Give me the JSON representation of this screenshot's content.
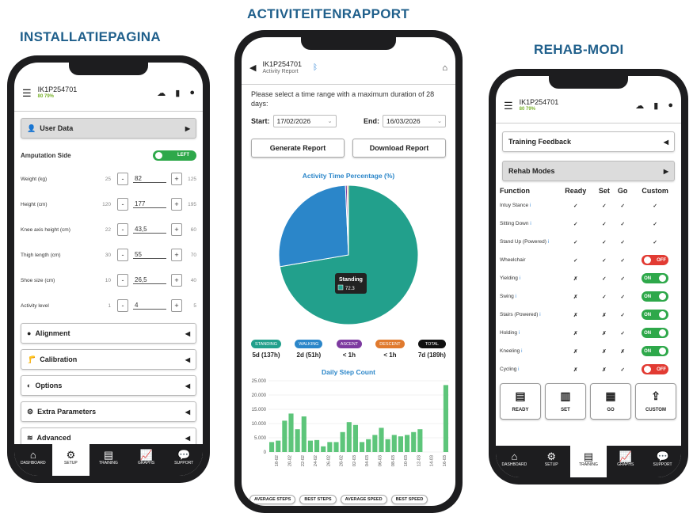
{
  "headings": {
    "left": "INSTALLATIEPAGINA",
    "middle": "ACTIVITEITENRAPPORT",
    "right": "REHAB-MODI"
  },
  "device": {
    "id": "IK1P254701",
    "battery": "80 79%"
  },
  "setup": {
    "user_data": "User Data",
    "amputation_side": "Amputation Side",
    "amputation_value": "LEFT",
    "fields": [
      {
        "label": "Weight (kg)",
        "min": "25",
        "value": "82",
        "max": "125"
      },
      {
        "label": "Height (cm)",
        "min": "120",
        "value": "177",
        "max": "195"
      },
      {
        "label": "Knee axis height (cm)",
        "min": "22",
        "value": "43,5",
        "max": "60"
      },
      {
        "label": "Thigh length (cm)",
        "min": "30",
        "value": "55",
        "max": "70"
      },
      {
        "label": "Shoe size (cm)",
        "min": "10",
        "value": "26,5",
        "max": "40"
      },
      {
        "label": "Activity level",
        "min": "1",
        "value": "4",
        "max": "5"
      }
    ],
    "sections": [
      "Alignment",
      "Calibration",
      "Options",
      "Extra Parameters",
      "Advanced"
    ]
  },
  "nav": [
    "DASHBOARD",
    "SETUP",
    "TRAINING",
    "GRAPHS",
    "SUPPORT"
  ],
  "report": {
    "title": "Activity Report",
    "instruction": "Please select a time range with a maximum duration of 28 days:",
    "start_label": "Start:",
    "start_value": "17/02/2026",
    "end_label": "End:",
    "end_value": "16/03/2026",
    "generate": "Generate Report",
    "download": "Download Report",
    "pie_title": "Activity Time Percentage (%)",
    "tooltip_label": "Standing",
    "tooltip_value": "72.3",
    "badges": [
      {
        "label": "STANDING",
        "value": "5d (137h)",
        "color": "#22a08c"
      },
      {
        "label": "WALKING",
        "value": "2d (51h)",
        "color": "#2b86c9"
      },
      {
        "label": "ASCENT",
        "value": "< 1h",
        "color": "#7d3aa0"
      },
      {
        "label": "DESCENT",
        "value": "< 1h",
        "color": "#e07a2e"
      },
      {
        "label": "TOTAL",
        "value": "7d (189h)",
        "color": "#111111"
      }
    ],
    "bar_title": "Daily Step Count",
    "bottom_tabs": [
      "AVERAGE STEPS",
      "BEST STEPS",
      "AVERAGE SPEED",
      "BEST SPEED"
    ]
  },
  "chart_data": [
    {
      "type": "pie",
      "title": "Activity Time Percentage (%)",
      "categories": [
        "Standing",
        "Walking",
        "Ascent",
        "Descent"
      ],
      "values": [
        72.3,
        27.0,
        0.4,
        0.3
      ],
      "colors": [
        "#22a08c",
        "#2b86c9",
        "#7d3aa0",
        "#e07a2e"
      ]
    },
    {
      "type": "bar",
      "title": "Daily Step Count",
      "yticks": [
        "0",
        "5.000",
        "10.000",
        "15.000",
        "20.000",
        "25.000"
      ],
      "ylim": [
        0,
        25000
      ],
      "categories": [
        "17-02",
        "18-02",
        "19-02",
        "20-02",
        "21-02",
        "22-02",
        "23-02",
        "24-02",
        "25-02",
        "26-02",
        "27-02",
        "28-02",
        "01-03",
        "02-03",
        "03-03",
        "04-03",
        "05-03",
        "06-03",
        "07-03",
        "08-03",
        "09-03",
        "10-03",
        "11-03",
        "12-03",
        "13-03",
        "14-03",
        "15-03",
        "16-03"
      ],
      "xticklabels": [
        "18-02",
        "20-02",
        "22-02",
        "24-02",
        "26-02",
        "28-02",
        "02-03",
        "04-03",
        "06-03",
        "08-03",
        "10-03",
        "12-03",
        "14-03",
        "16-03"
      ],
      "values": [
        3500,
        4000,
        11000,
        13500,
        8000,
        12500,
        4000,
        4200,
        2000,
        3500,
        3500,
        7000,
        10500,
        9500,
        3500,
        4500,
        6000,
        8500,
        4500,
        6000,
        5500,
        6000,
        7000,
        8000,
        0,
        0,
        0,
        23500
      ],
      "color": "#5dc57a"
    }
  ],
  "rehab": {
    "training_feedback": "Training Feedback",
    "rehab_modes": "Rehab Modes",
    "headers": [
      "Function",
      "Ready",
      "Set",
      "Go",
      "Custom"
    ],
    "rows": [
      {
        "name": "Intuy Stance",
        "info": "i",
        "ready": "✓",
        "set": "✓",
        "go": "✓",
        "custom": "✓"
      },
      {
        "name": "Sitting Down",
        "info": "i",
        "ready": "✓",
        "set": "✓",
        "go": "✓",
        "custom": "✓"
      },
      {
        "name": "Stand Up (Powered)",
        "info": "i",
        "ready": "✓",
        "set": "✓",
        "go": "✓",
        "custom": "✓"
      },
      {
        "name": "Wheelchair",
        "info": "",
        "ready": "✓",
        "set": "✓",
        "go": "✓",
        "custom": "OFF"
      },
      {
        "name": "Yielding",
        "info": "i",
        "ready": "✗",
        "set": "✓",
        "go": "✓",
        "custom": "ON"
      },
      {
        "name": "Swing",
        "info": "i",
        "ready": "✗",
        "set": "✓",
        "go": "✓",
        "custom": "ON"
      },
      {
        "name": "Stairs (Powered)",
        "info": "i",
        "ready": "✗",
        "set": "✗",
        "go": "✓",
        "custom": "ON"
      },
      {
        "name": "Holding",
        "info": "i",
        "ready": "✗",
        "set": "✗",
        "go": "✓",
        "custom": "ON"
      },
      {
        "name": "Kneeling",
        "info": "i",
        "ready": "✗",
        "set": "✗",
        "go": "✗",
        "custom": "ON"
      },
      {
        "name": "Cycling",
        "info": "i",
        "ready": "✗",
        "set": "✗",
        "go": "✓",
        "custom": "OFF"
      }
    ],
    "modes": [
      "READY",
      "SET",
      "GO",
      "CUSTOM"
    ]
  }
}
